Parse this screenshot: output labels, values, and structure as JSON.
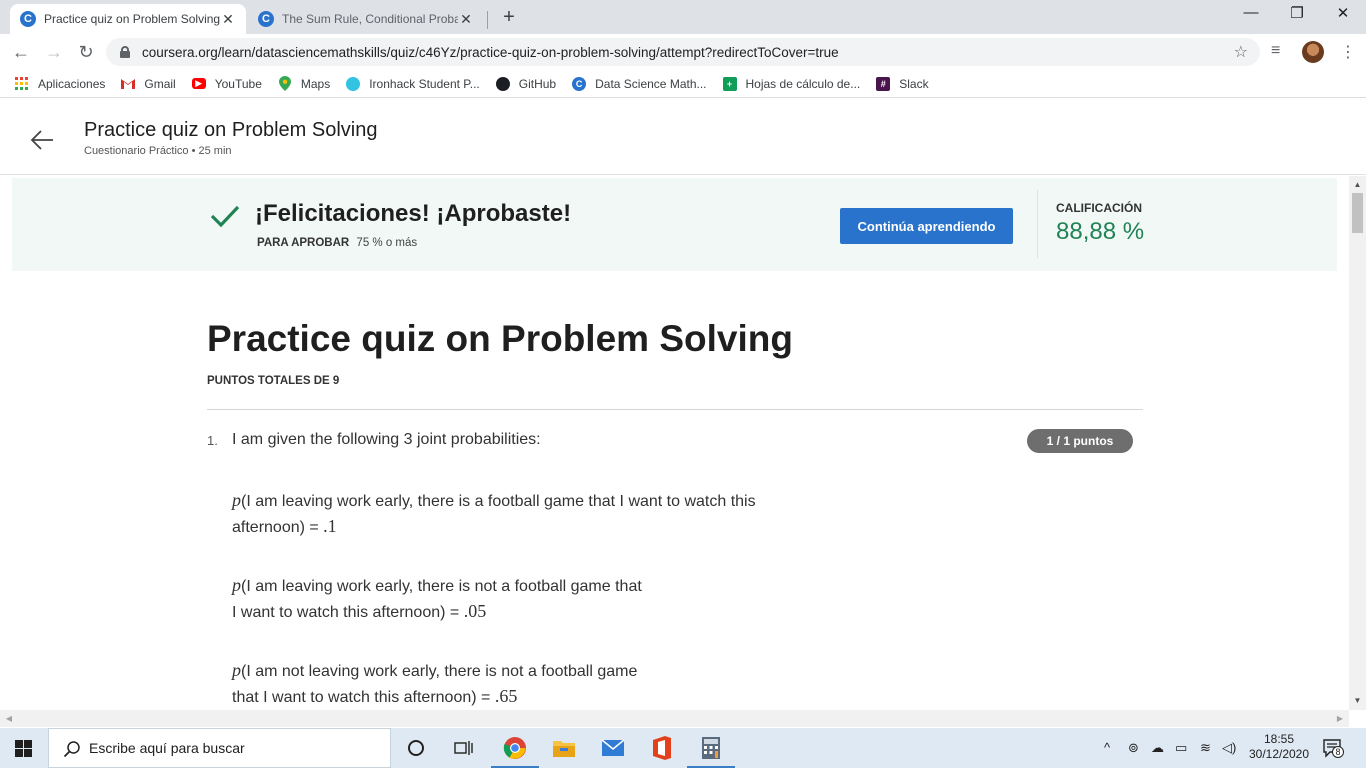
{
  "browser": {
    "tabs": [
      {
        "title": "Practice quiz on Problem Solving",
        "favicon": "C",
        "active": true
      },
      {
        "title": "The Sum Rule, Conditional Proba",
        "favicon": "C",
        "active": false
      }
    ],
    "new_tab": "+",
    "window_controls": {
      "minimize": "—",
      "restore": "❐",
      "close": "✕"
    },
    "url": "coursera.org/learn/datasciencemathskills/quiz/c46Yz/practice-quiz-on-problem-solving/attempt?redirectToCover=true",
    "bookmarks": [
      {
        "label": "Aplicaciones",
        "icon": "apps-grid-icon",
        "color": "#4285f4"
      },
      {
        "label": "Gmail",
        "icon": "gmail-icon",
        "color": "#d93025"
      },
      {
        "label": "YouTube",
        "icon": "youtube-icon",
        "color": "#ff0000"
      },
      {
        "label": "Maps",
        "icon": "maps-pin-icon",
        "color": "#34a853"
      },
      {
        "label": "Ironhack Student P...",
        "icon": "ironhack-icon",
        "color": "#32c3e0"
      },
      {
        "label": "GitHub",
        "icon": "github-icon",
        "color": "#1b1f23"
      },
      {
        "label": "Data Science Math...",
        "icon": "coursera-icon",
        "color": "#2a73cc"
      },
      {
        "label": "Hojas de cálculo de...",
        "icon": "sheets-icon",
        "color": "#0f9d58"
      },
      {
        "label": "Slack",
        "icon": "slack-icon",
        "color": "#4a154b"
      }
    ]
  },
  "header": {
    "title": "Practice quiz on Problem Solving",
    "subtitle": "Cuestionario Práctico • 25 min"
  },
  "banner": {
    "congrats": "¡Felicitaciones! ¡Aprobaste!",
    "pass_label": "PARA APROBAR",
    "pass_value": "75 % o más",
    "continue_button": "Continúa aprendiendo",
    "grade_label": "CALIFICACIÓN",
    "grade_value": "88,88 %",
    "accent_color": "#1f8354",
    "button_color": "#2a73cc"
  },
  "quiz": {
    "title": "Practice quiz on Problem Solving",
    "total_points": "PUNTOS TOTALES DE 9",
    "question_number": "1.",
    "question_text": "I am given the following 3 joint probabilities:",
    "points_badge": "1 / 1 puntos",
    "probabilities": [
      {
        "p": "p",
        "line1": "(I am leaving work early, there is a football game that I want to watch this",
        "line2": "afternoon) = ",
        "value": ".1"
      },
      {
        "p": "p",
        "line1": "(I am leaving work early, there is not a football game that",
        "line2": "I want to watch this afternoon) = ",
        "value": ".05"
      },
      {
        "p": "p",
        "line1": "(I am not leaving work early, there is not a football game",
        "line2": "that I want to watch this afternoon) = ",
        "value": ".65"
      }
    ]
  },
  "taskbar": {
    "search_placeholder": "Escribe aquí para buscar",
    "time": "18:55",
    "date": "30/12/2020",
    "notifications": "8"
  }
}
